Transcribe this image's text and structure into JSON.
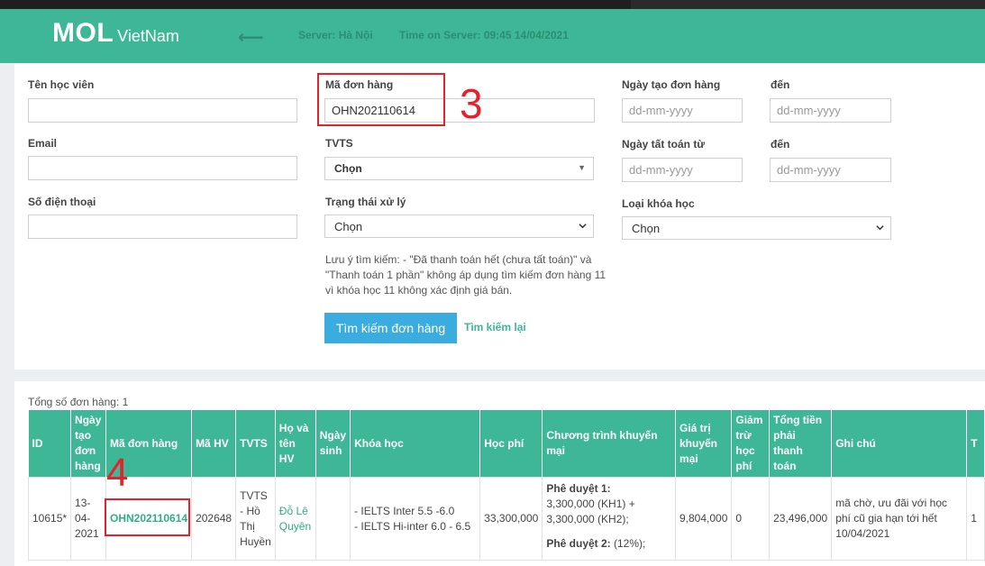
{
  "header": {
    "logo_main": "MOL",
    "logo_sub": "VietNam",
    "back_icon": "arrow-left-icon",
    "server": "Server: Hà Nội",
    "time": "Time on Server: 09:45 14/04/2021"
  },
  "filters": {
    "student_name": {
      "label": "Tên học viên",
      "value": ""
    },
    "order_code": {
      "label": "Mã đơn hàng",
      "value": "OHN202110614"
    },
    "created_from": {
      "label": "Ngày tạo đơn hàng",
      "placeholder": "dd-mm-yyyy"
    },
    "created_to": {
      "label": "đến",
      "placeholder": "dd-mm-yyyy"
    },
    "email": {
      "label": "Email",
      "value": ""
    },
    "tvts": {
      "label": "TVTS",
      "value": "Chọn"
    },
    "settled_from": {
      "label": "Ngày tất toán từ",
      "placeholder": "dd-mm-yyyy"
    },
    "settled_to": {
      "label": "đến",
      "placeholder": "dd-mm-yyyy"
    },
    "phone": {
      "label": "Số điện thoại",
      "value": ""
    },
    "status": {
      "label": "Trạng thái xử lý",
      "value": "Chọn"
    },
    "course_type": {
      "label": "Loại khóa học",
      "value": "Chọn"
    },
    "note": "Lưu ý tìm kiếm: - \"Đã thanh toán hết (chưa tất toán)\" và \"Thanh toán 1 phần\" không áp dụng tìm kiếm đơn hàng 11 vì khóa học 11 không xác định giá bán.",
    "search_button": "Tìm kiếm đơn hàng",
    "reset_link": "Tìm kiếm lại"
  },
  "annotations": {
    "step3": "3",
    "step4": "4"
  },
  "results": {
    "total": "Tổng số đơn hàng: 1",
    "columns": [
      "ID",
      "Ngày tạo đơn hàng",
      "Mã đơn hàng",
      "Mã HV",
      "TVTS",
      "Họ và tên HV",
      "Ngày sinh",
      "Khóa học",
      "Học phí",
      "Chương trình khuyến mại",
      "Giá trị khuyến mại",
      "Giảm trừ học phí",
      "Tổng tiền phải thanh toán",
      "Ghi chú",
      "T"
    ],
    "rows": [
      {
        "id": "10615*",
        "created": "13-04-2021",
        "order_code": "OHN202110614",
        "student_code": "202648",
        "tvts": "TVTS - Hồ Thị Huyền",
        "student_name": "Đỗ Lê Quyên",
        "dob": "",
        "course_1": "- IELTS Inter 5.5 -6.0",
        "course_2": "- IELTS Hi-inter 6.0 - 6.5",
        "fee": "33,300,000",
        "promo_title_1": "Phê duyệt 1:",
        "promo_text_1": "3,300,000 (KH1) + 3,300,000 (KH2);",
        "promo_title_2": "Phê duyệt 2:",
        "promo_text_2": "(12%);",
        "promo_value": "9,804,000",
        "deduction": "0",
        "total": "23,496,000",
        "note": "mã chờ, ưu đãi với học phí cũ gia hạn tới hết 10/04/2021",
        "last": "1"
      }
    ]
  }
}
